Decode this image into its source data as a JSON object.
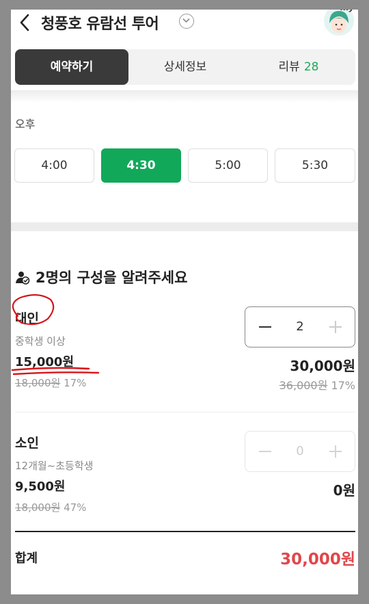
{
  "header": {
    "title": "청풍호 유람선 투어",
    "avatar_badge": "my"
  },
  "tabs": [
    {
      "label": "예약하기",
      "active": true
    },
    {
      "label": "상세정보",
      "active": false
    },
    {
      "label": "리뷰",
      "count": "28",
      "active": false
    }
  ],
  "time_section": {
    "label": "오후",
    "slots": [
      {
        "label": "4:00",
        "selected": false
      },
      {
        "label": "4:30",
        "selected": true
      },
      {
        "label": "5:00",
        "selected": false
      },
      {
        "label": "5:30",
        "selected": false
      }
    ]
  },
  "people": {
    "title": "2명의 구성을 알려주세요",
    "rows": [
      {
        "name": "대인",
        "desc": "중학생 이상",
        "price": "15,000원",
        "orig_price": "18,000원",
        "discount": "17%",
        "qty": "2",
        "total": "30,000원",
        "total_orig": "36,000원",
        "total_discount": "17%"
      },
      {
        "name": "소인",
        "desc": "12개월~초등학생",
        "price": "9,500원",
        "orig_price": "18,000원",
        "discount": "47%",
        "qty": "0",
        "total": "0원"
      }
    ]
  },
  "summary": {
    "label": "합계",
    "value": "30,000원"
  },
  "colors": {
    "accent_green": "#12a85a",
    "total_red": "#e0474c",
    "annotation_red": "#d6161b"
  }
}
